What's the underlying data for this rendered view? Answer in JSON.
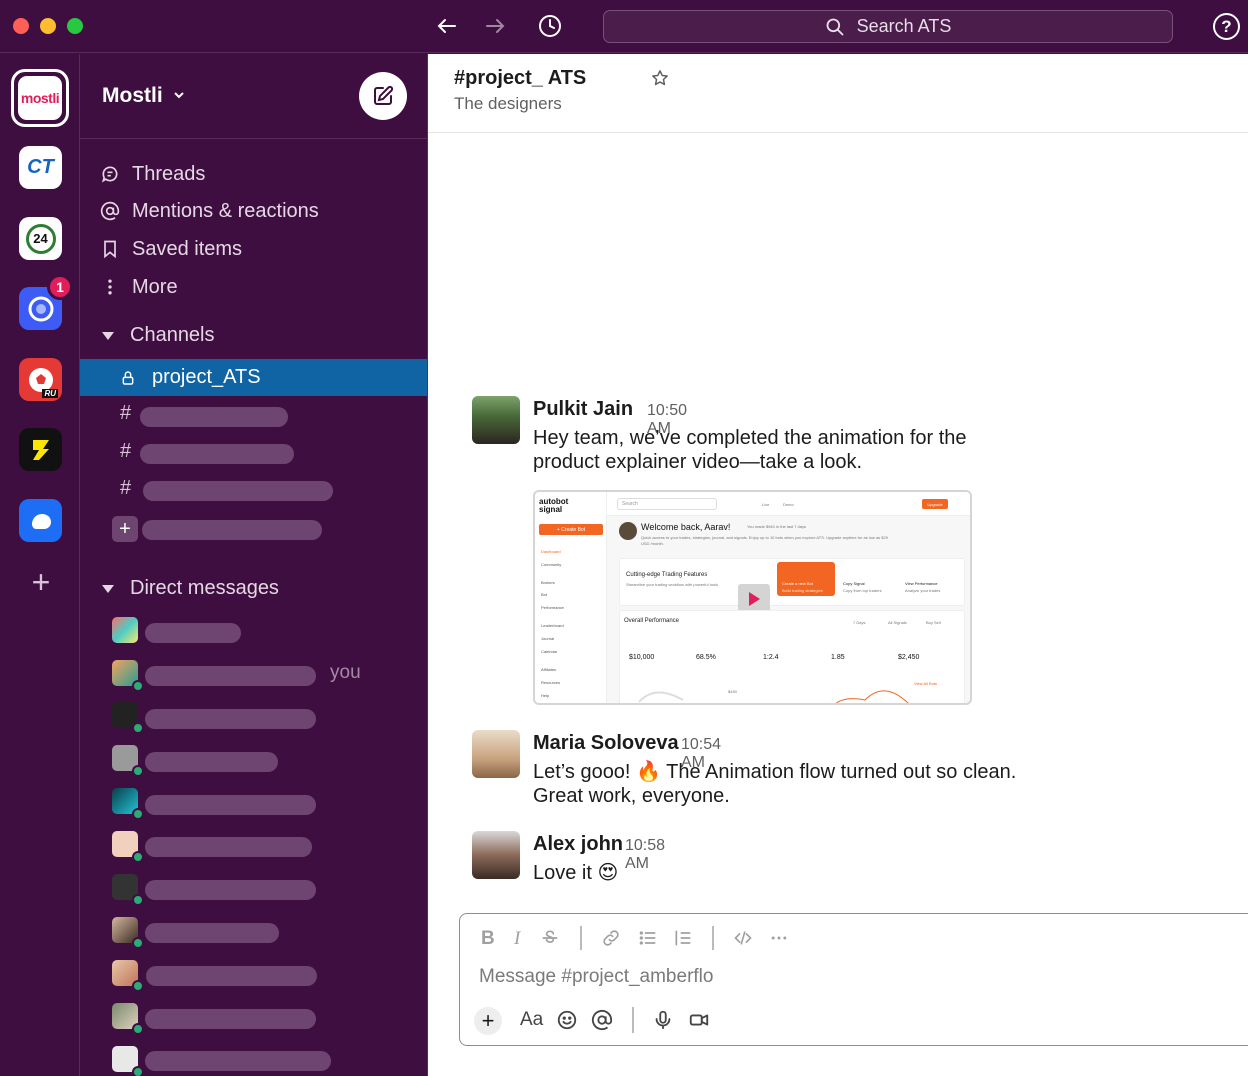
{
  "window": {
    "search_text": "Search ATS",
    "help_label": "?"
  },
  "rail": {
    "active_workspace_label": "mostli",
    "ct_label": "CT",
    "ws24_label": "24",
    "badge_count": "1",
    "ball_label": "RU",
    "add_label": "+"
  },
  "sidebar": {
    "workspace_name": "Mostli",
    "items": [
      {
        "label": "Threads"
      },
      {
        "label": "Mentions & reactions"
      },
      {
        "label": "Saved items"
      },
      {
        "label": "More"
      }
    ],
    "channels_header": "Channels",
    "active_channel": "project_ATS",
    "channel_hash": "#",
    "add_channel": "+",
    "dm_header": "Direct messages",
    "you_label": "you"
  },
  "channel": {
    "title": "#project_ ATS",
    "description": "The designers"
  },
  "messages": [
    {
      "name": "Pulkit Jain",
      "time": "10:50 AM",
      "text": "Hey team, we’ve completed the animation for the product explainer video—take a look."
    },
    {
      "name": "Maria Soloveva",
      "time": "10:54 AM",
      "text": "Let’s gooo! 🔥 The Animation flow turned out so clean. Great work, everyone."
    },
    {
      "name": "Alex john",
      "time": "10:58 AM",
      "text": "Love it 😍"
    }
  ],
  "attachment": {
    "logo": "autobot signal",
    "create_bot": "+ Create Bot",
    "nav": [
      "Dashboard",
      "Community",
      "Brokers",
      "Bot",
      "Performance",
      "Leaderboard",
      "Journal",
      "Calendar",
      "Affiliates",
      "Resources",
      "Help"
    ],
    "search": "Search",
    "top_live": "Live",
    "top_demo": "Demo",
    "upgrade": "Upgrade",
    "welcome": "Welcome back, Aarav!",
    "welcome_note": "You made $940 in the last 7 days",
    "welcome_sub": "Quick access to your trades, strategies, journal, and signals. Enjoy up to 10 bots when you explore ATS. Upgrade anytime for as low as $29 USD /month.",
    "features_title": "Cutting-edge Trading Features",
    "features_sub": "Streamline your trading workflow with powerful tools",
    "create_new_bot": "Create a new Bot",
    "create_new_bot_sub": "Build trading strategies",
    "copy_signal": "Copy Signal",
    "copy_signal_sub": "Copy from top traders",
    "view_performance": "View Performance",
    "view_performance_sub": "Analyze your trades",
    "overall": "Overall Performance",
    "filter_days": "7 Days",
    "filter_signals": "All Signals",
    "filter_buysell": "Buy Sell",
    "stats": [
      "$10,000",
      "68.5%",
      "1:2.4",
      "1.85",
      "$2,450"
    ],
    "view_all": "View All Bots",
    "chart_value": "$450"
  },
  "composer": {
    "bold": "B",
    "italic": "I",
    "placeholder": "Message #project_amberflo",
    "plus": "+",
    "text_format": "Aa"
  },
  "colors": {
    "aubergine": "#3f0e40",
    "active_blue": "#1164a3",
    "badge_red": "#e01e5a",
    "online_green": "#2bac76",
    "accent_orange": "#f26522"
  }
}
